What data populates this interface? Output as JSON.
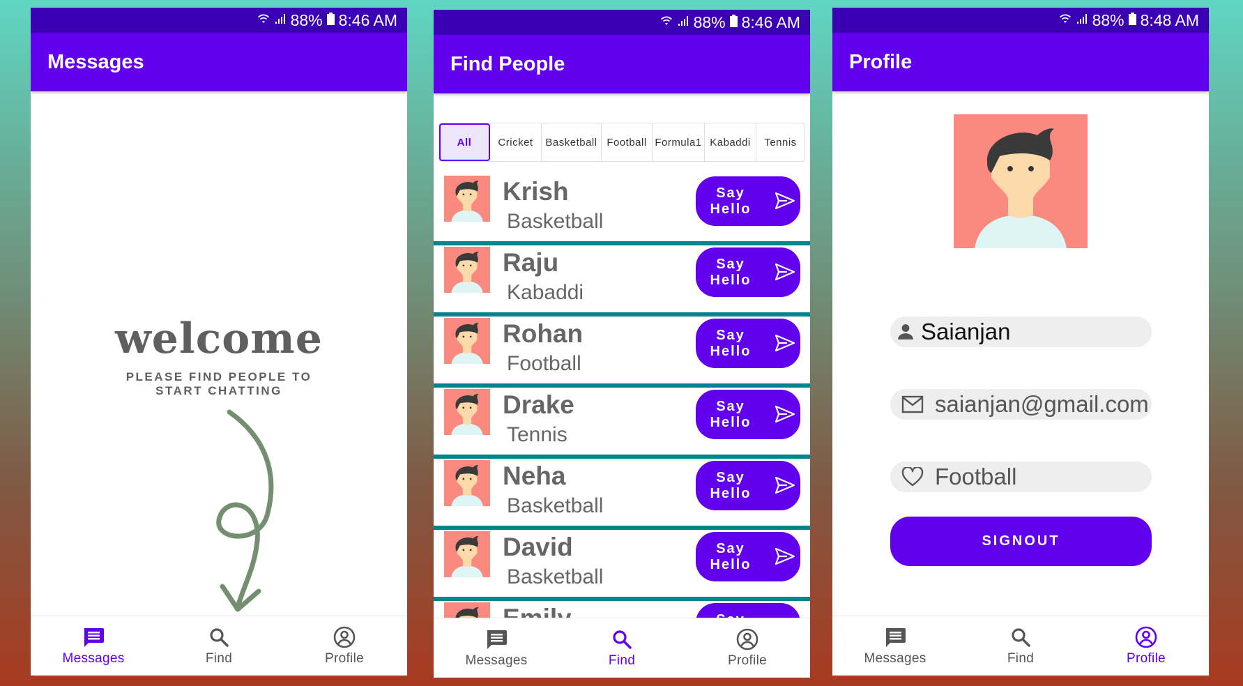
{
  "status_bar": [
    {
      "battery": "88%",
      "time": "8:46 AM"
    },
    {
      "battery": "88%",
      "time": "8:46 AM"
    },
    {
      "battery": "88%",
      "time": "8:48 AM"
    }
  ],
  "messages_screen": {
    "title": "Messages",
    "welcome": "welcome",
    "subtitle_line1": "PLEASE FIND PEOPLE TO",
    "subtitle_line2": "START CHATTING"
  },
  "find_screen": {
    "title": "Find People",
    "filters": [
      "All",
      "Cricket",
      "Basketball",
      "Football",
      "Formula1",
      "Kabaddi",
      "Tennis"
    ],
    "selected_filter": "All",
    "hello_line1": "Say",
    "hello_line2": "Hello",
    "people": [
      {
        "name": "Krish",
        "sport": "Basketball"
      },
      {
        "name": "Raju",
        "sport": "Kabaddi"
      },
      {
        "name": "Rohan",
        "sport": "Football"
      },
      {
        "name": "Drake",
        "sport": "Tennis"
      },
      {
        "name": "Neha",
        "sport": "Basketball"
      },
      {
        "name": "David",
        "sport": "Basketball"
      },
      {
        "name": "Emily",
        "sport": ""
      }
    ]
  },
  "profile_screen": {
    "title": "Profile",
    "name": "Saianjan",
    "email": "saianjan@gmail.com",
    "favorite_sport": "Football",
    "signout_label": "SIGNOUT"
  },
  "bottom_nav": {
    "items": [
      "Messages",
      "Find",
      "Profile"
    ]
  },
  "colors": {
    "primary": "#6200ee",
    "status_bar": "#3b00b3",
    "divider_teal": "#00858a",
    "avatar_bg": "#fa8a7f"
  }
}
